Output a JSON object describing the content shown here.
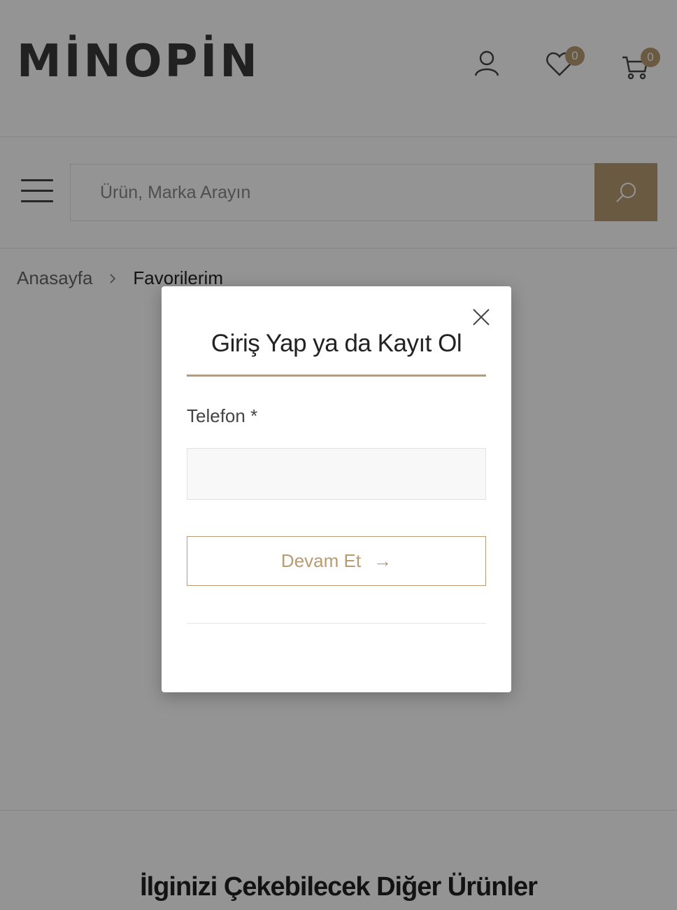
{
  "header": {
    "logo_text": "MİNOPİN",
    "wishlist_count": "0",
    "cart_count": "0",
    "icons": {
      "user": "user-icon",
      "wishlist": "heart-icon",
      "cart": "cart-icon",
      "menu": "hamburger-menu-icon",
      "search": "search-icon"
    }
  },
  "search": {
    "placeholder": "Ürün, Marka Arayın"
  },
  "breadcrumb": {
    "items": [
      "Anasayfa",
      "Favorilerim"
    ]
  },
  "section": {
    "title": "İlginizi Çekebilecek Diğer Ürünler"
  },
  "modal": {
    "title": "Giriş Yap ya da Kayıt Ol",
    "phone_label": "Telefon *",
    "phone_value": "",
    "continue_label": "Devam Et",
    "continue_arrow": "→"
  },
  "colors": {
    "accent": "#b89b72",
    "overlay": "rgba(0,0,0,0.42)",
    "text": "#222222"
  }
}
